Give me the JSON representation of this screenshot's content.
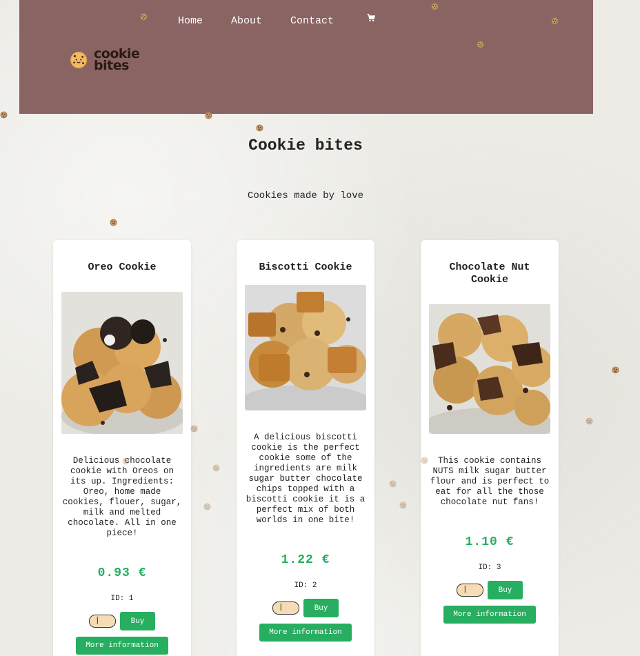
{
  "nav": {
    "home": "Home",
    "about": "About",
    "contact": "Contact"
  },
  "logo": {
    "line1": "cookie",
    "line2": "bites"
  },
  "page": {
    "title": "Cookie bites",
    "tagline": "Cookies made by love"
  },
  "products": [
    {
      "name": "Oreo Cookie",
      "description": "Delicious chocolate cookie with Oreos on its up. Ingredients: Oreo, home made cookies, flouer, sugar, milk and melted chocolate. All in one piece!",
      "price": "0.93 €",
      "id_label": "ID: 1",
      "qty_value": "|",
      "buy_label": "Buy",
      "more_label": "More information"
    },
    {
      "name": "Biscotti Cookie",
      "description": "A delicious biscotti cookie is the perfect cookie some of the ingredients are milk sugar butter chocolate chips topped with a biscotti cookie it is a perfect mix of both worlds in one bite!",
      "price": "1.22 €",
      "id_label": "ID: 2",
      "qty_value": "|",
      "buy_label": "Buy",
      "more_label": "More information"
    },
    {
      "name": "Chocolate Nut Cookie",
      "description": "This cookie contains NUTS milk sugar butter flour and is perfect to eat for all the those chocolate nut fans!",
      "price": "1.10 €",
      "id_label": "ID: 3",
      "qty_value": "|",
      "buy_label": "Buy",
      "more_label": "More information"
    }
  ],
  "colors": {
    "header": "#8a6363",
    "accent": "#27ae60",
    "qty_bg": "#f5dcb4"
  },
  "icons": [
    "cart-icon",
    "cookie-logo-icon",
    "cookie-sprinkle-icon"
  ]
}
